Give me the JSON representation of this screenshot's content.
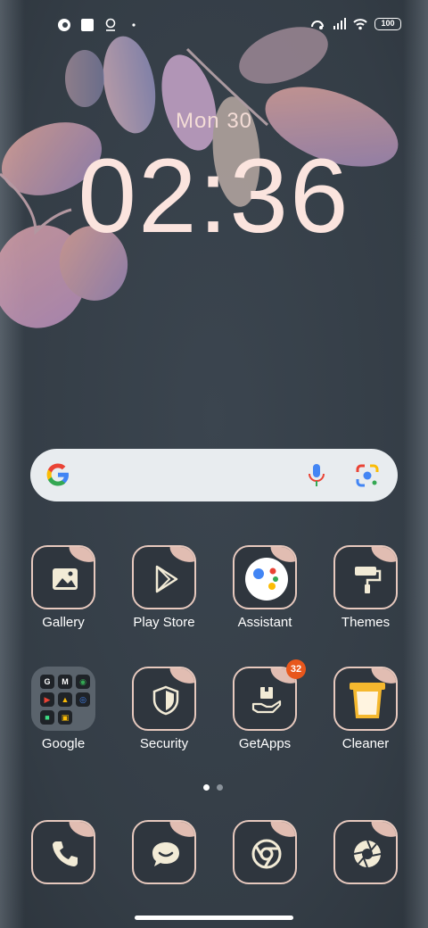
{
  "status_bar": {
    "battery": "100",
    "icons_left": [
      "notification-app-icon",
      "square-notification-icon",
      "location-icon",
      "dot-icon"
    ],
    "icons_right": [
      "hotspot-icon",
      "signal-icon",
      "wifi-icon",
      "battery-icon"
    ]
  },
  "clock": {
    "date": "Mon 30",
    "time": "02:36"
  },
  "search_bar": {
    "icons": [
      "google-g-icon",
      "microphone-icon",
      "lens-camera-icon"
    ]
  },
  "apps_row1": [
    {
      "label": "Gallery",
      "icon": "gallery-icon"
    },
    {
      "label": "Play Store",
      "icon": "play-store-icon"
    },
    {
      "label": "Assistant",
      "icon": "assistant-icon"
    },
    {
      "label": "Themes",
      "icon": "paint-roller-icon"
    }
  ],
  "apps_row2": [
    {
      "label": "Google",
      "icon": "google-folder-icon"
    },
    {
      "label": "Security",
      "icon": "shield-icon"
    },
    {
      "label": "GetApps",
      "icon": "getapps-icon",
      "badge": "32"
    },
    {
      "label": "Cleaner",
      "icon": "trash-bin-icon"
    }
  ],
  "folder_items": [
    "G",
    "M",
    "◉",
    "▶",
    "▲",
    "◎",
    "■",
    "▣",
    ""
  ],
  "dock": [
    {
      "icon": "phone-icon"
    },
    {
      "icon": "messages-icon"
    },
    {
      "icon": "chrome-icon"
    },
    {
      "icon": "camera-shutter-icon"
    }
  ],
  "page_indicator": {
    "pages": 2,
    "active": 1
  },
  "colors": {
    "background": "#39424b",
    "clock": "#fbe4de",
    "icon_accent": "#e7c9be",
    "badge": "#e8571c"
  }
}
